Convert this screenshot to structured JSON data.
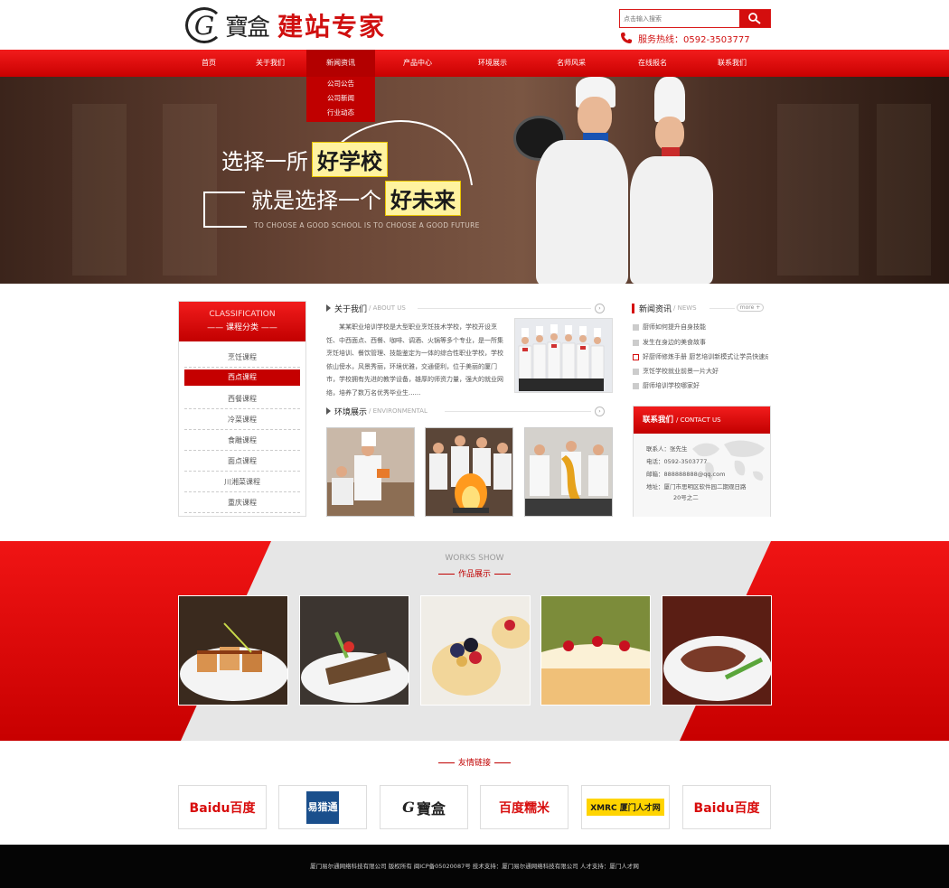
{
  "header": {
    "logo_text": "寶盒",
    "slogan": "建站专家",
    "search_placeholder": "点击输入搜索",
    "hotline": "服务热线：0592-3503777"
  },
  "nav": {
    "items": [
      "首页",
      "关于我们",
      "新闻资讯",
      "产品中心",
      "环境展示",
      "名师风采",
      "在线报名",
      "联系我们"
    ],
    "active_index": 2,
    "dropdown": [
      "公司公告",
      "公司新闻",
      "行业动态"
    ]
  },
  "banner": {
    "line1_prefix": "选择一所",
    "line1_highlight": "好学校",
    "line2_prefix": "就是选择一个",
    "line2_highlight": "好未来",
    "en": "TO CHOOSE A GOOD SCHOOL IS TO CHOOSE A GOOD FUTURE"
  },
  "sidebar": {
    "title_en": "CLASSIFICATION",
    "title_cn": "—— 课程分类 ——",
    "items": [
      "烹饪课程",
      "西点课程",
      "西餐课程",
      "冷菜课程",
      "食雕课程",
      "面点课程",
      "川湘菜课程",
      "重庆课程"
    ],
    "active_index": 1
  },
  "about": {
    "title": "关于我们",
    "title_en": "/ ABOUT US",
    "text": "某某职业培训学校是大型职业烹饪技术学校，学校开设烹饪、中西面点、西餐、咖啡、调酒、火锅等多个专业，是一所集烹饪培训、餐饮管理、技能鉴定为一体的综合性职业学校，学校依山傍水，风景秀丽，环境优雅，交通便利，位于美丽的厦门市，学校拥有先进的教学设备，雄厚的师资力量，强大的就业网络，培养了数万名优秀毕业生......"
  },
  "env": {
    "title": "环境展示",
    "title_en": "/ ENVIRONMENTAL"
  },
  "news": {
    "title": "新闻资讯",
    "title_en": "/ NEWS",
    "more": "more",
    "items": [
      "厨师如何提升自身技能",
      "发生在身边的美食故事",
      "好厨师修炼手册 厨艺培训新模式让学员快速成长",
      "烹饪学校就业前景一片大好",
      "厨师培训学校哪家好"
    ]
  },
  "contact": {
    "title": "联系我们",
    "title_en": "/ CONTACT US",
    "lines": [
      "联系人：张先生",
      "电话：0592-3503777",
      "邮箱：888888888@qq.com",
      "地址：厦门市思明区软件园二期观日路",
      "20号之二"
    ]
  },
  "works": {
    "title_en": "WORKS SHOW",
    "title_cn": "作品展示"
  },
  "links": {
    "title": "友情链接",
    "items": [
      "Baidu百度",
      "易猎通",
      "寶盒",
      "百度糯米",
      "XMRC 厦门人才网",
      "Baidu百度"
    ]
  },
  "footer": {
    "text": "厦门易尔通网络科技有限公司 版权所有  闽ICP备05020087号 技术支持：厦门易尔通网络科技有限公司 人才支持：厦门人才网"
  },
  "colors": {
    "brand_red": "#d40e0e",
    "works_bg": "#e6e6e6",
    "footer_bg": "#050505"
  }
}
